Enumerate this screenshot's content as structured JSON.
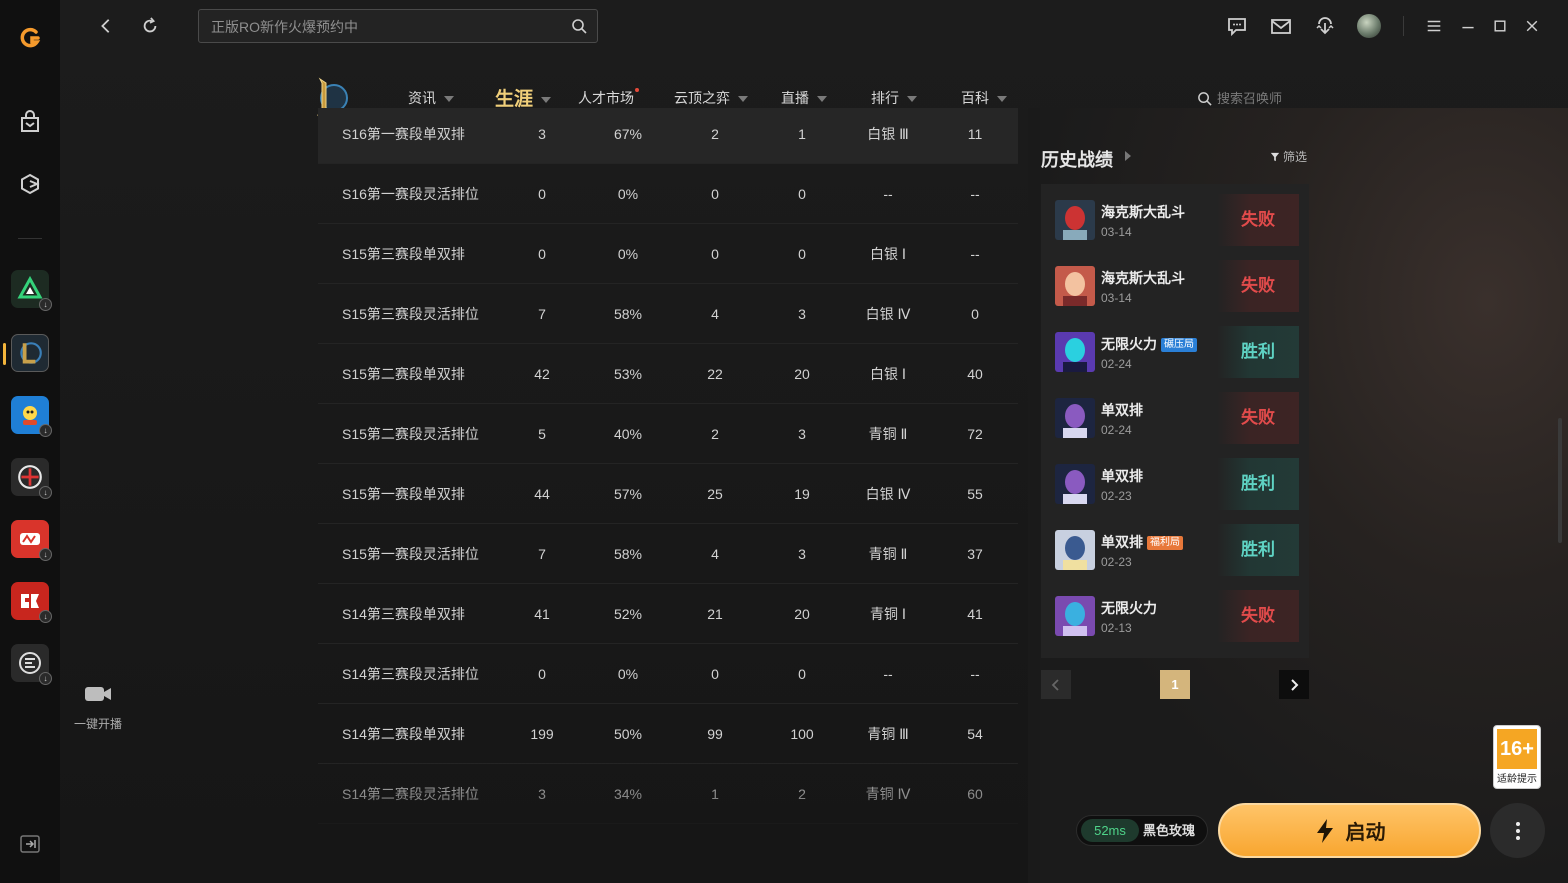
{
  "topbar": {
    "search_placeholder": "正版RO新作火爆预约中"
  },
  "nav": {
    "items": [
      {
        "label": "资讯"
      },
      {
        "label": "生涯"
      },
      {
        "label": "人才市场"
      },
      {
        "label": "云顶之弈"
      },
      {
        "label": "直播"
      },
      {
        "label": "排行"
      },
      {
        "label": "百科"
      }
    ],
    "summoner_search": "搜索召唤师"
  },
  "rank_table": {
    "rows": [
      [
        "S16第一赛段单双排",
        "3",
        "67%",
        "2",
        "1",
        "白银 Ⅲ",
        "11"
      ],
      [
        "S16第一赛段灵活排位",
        "0",
        "0%",
        "0",
        "0",
        "--",
        "--"
      ],
      [
        "S15第三赛段单双排",
        "0",
        "0%",
        "0",
        "0",
        "白银 Ⅰ",
        "--"
      ],
      [
        "S15第三赛段灵活排位",
        "7",
        "58%",
        "4",
        "3",
        "白银 Ⅳ",
        "0"
      ],
      [
        "S15第二赛段单双排",
        "42",
        "53%",
        "22",
        "20",
        "白银 Ⅰ",
        "40"
      ],
      [
        "S15第二赛段灵活排位",
        "5",
        "40%",
        "2",
        "3",
        "青铜 Ⅱ",
        "72"
      ],
      [
        "S15第一赛段单双排",
        "44",
        "57%",
        "25",
        "19",
        "白银 Ⅳ",
        "55"
      ],
      [
        "S15第一赛段灵活排位",
        "7",
        "58%",
        "4",
        "3",
        "青铜 Ⅱ",
        "37"
      ],
      [
        "S14第三赛段单双排",
        "41",
        "52%",
        "21",
        "20",
        "青铜 Ⅰ",
        "41"
      ],
      [
        "S14第三赛段灵活排位",
        "0",
        "0%",
        "0",
        "0",
        "--",
        "--"
      ],
      [
        "S14第二赛段单双排",
        "199",
        "50%",
        "99",
        "100",
        "青铜 Ⅲ",
        "54"
      ],
      [
        "S14第二赛段灵活排位",
        "3",
        "34%",
        "1",
        "2",
        "青铜 Ⅳ",
        "60"
      ]
    ]
  },
  "history": {
    "title": "历史战绩",
    "filter": "筛选",
    "matches": [
      {
        "mode": "海克斯大乱斗",
        "tag": "",
        "date": "03-14",
        "result": "失败",
        "outcome": "lose"
      },
      {
        "mode": "海克斯大乱斗",
        "tag": "",
        "date": "03-14",
        "result": "失败",
        "outcome": "lose"
      },
      {
        "mode": "无限火力",
        "tag": "碾压局",
        "date": "02-24",
        "result": "胜利",
        "outcome": "win"
      },
      {
        "mode": "单双排",
        "tag": "",
        "date": "02-24",
        "result": "失败",
        "outcome": "lose"
      },
      {
        "mode": "单双排",
        "tag": "",
        "date": "02-23",
        "result": "胜利",
        "outcome": "win"
      },
      {
        "mode": "单双排",
        "tag": "福利局",
        "date": "02-23",
        "result": "胜利",
        "outcome": "win"
      },
      {
        "mode": "无限火力",
        "tag": "",
        "date": "02-13",
        "result": "失败",
        "outcome": "lose"
      }
    ],
    "page": "1"
  },
  "live": {
    "label": "一键开播"
  },
  "footer": {
    "ping": "52ms",
    "server": "黑色玫瑰",
    "launch": "启动",
    "age_rating": "16+",
    "age_hint": "适龄提示"
  },
  "colors": {
    "accent": "#f8a630",
    "win": "#5fd3c4",
    "lose": "#e24b4b",
    "nav_active": "#f0cf7a"
  }
}
